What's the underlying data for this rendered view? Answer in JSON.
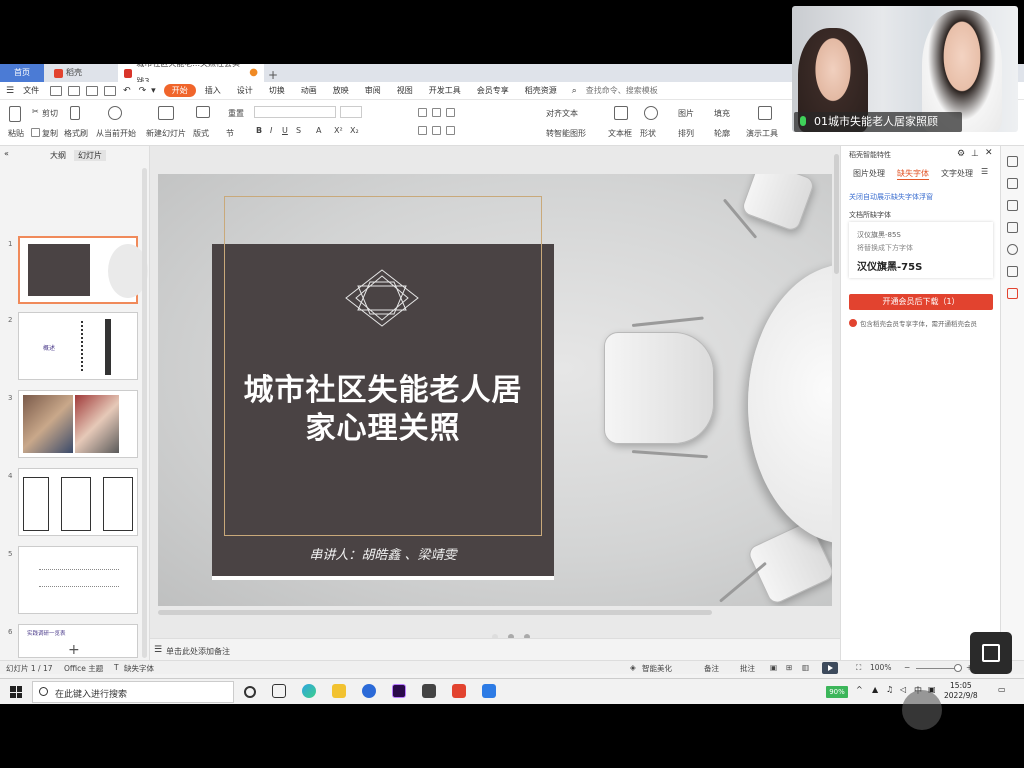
{
  "tabs": {
    "home": "首页",
    "wps": "稻壳",
    "doc": "城市社区失能老...关照社会实践3"
  },
  "menu": {
    "file": "文件",
    "items": [
      "开始",
      "插入",
      "设计",
      "切换",
      "动画",
      "放映",
      "审阅",
      "视图",
      "开发工具",
      "会员专享",
      "稻壳资源"
    ],
    "search": "查找命令、搜索模板"
  },
  "ribbon": {
    "paste": "粘贴",
    "cut": "剪切",
    "copy": "复制",
    "format_painter": "格式刷",
    "start_from": "从当前开始",
    "new_slide": "新建幻灯片",
    "layout": "版式",
    "section": "节",
    "reset": "重置",
    "align_text": "对齐文本",
    "smart_art": "转智能图形",
    "textbox": "文本框",
    "shape": "形状",
    "picture": "图片",
    "arrange": "排列",
    "fill": "填充",
    "outline": "轮廓",
    "presentation_tools": "演示工具"
  },
  "left_panel": {
    "tab_outline": "大纲",
    "tab_slides": "幻灯片",
    "slide_numbers": [
      "1",
      "2",
      "3",
      "4",
      "5",
      "6"
    ],
    "thumb2_label": "概述",
    "thumb6_label": "实践调研一览表"
  },
  "slide": {
    "title_line1": "城市社区失能老人居",
    "title_line2": "家心理关照",
    "subtitle": "串讲人：胡皓鑫 、梁靖雯"
  },
  "notes": {
    "placeholder": "单击此处添加备注"
  },
  "right_panel": {
    "header": "稻壳智能特性",
    "tab_image": "图片处理",
    "tab_font": "缺失字体",
    "tab_text": "文字处理",
    "link": "关闭自动展示缺失字体浮窗",
    "doc_missing": "文档所缺字体",
    "font_missing": "汉仪旗黑-85S",
    "replace_hint": "将替换成下方字体",
    "font_replace": "汉仪旗黑-75S",
    "button": "开通会员后下载（1）",
    "note": "包含稻壳会员专享字体，需开通稻壳会员"
  },
  "status": {
    "slide_count": "幻灯片 1 / 17",
    "theme": "Office 主题",
    "missing_font": "缺失字体",
    "beautify": "智能美化",
    "notes": "备注",
    "comment": "批注",
    "zoom": "100%"
  },
  "taskbar": {
    "search_placeholder": "在此键入进行搜索",
    "battery": "90%",
    "ime": "中",
    "time": "15:05",
    "date": "2022/9/8"
  },
  "video": {
    "label": "01城市失能老人居家照顾"
  },
  "colors": {
    "accent": "#f0652b",
    "home_tab": "#4b7bd5",
    "title_box": "#4a4344",
    "frame_gold": "#c9a97a",
    "vip_button": "#e2432f"
  }
}
